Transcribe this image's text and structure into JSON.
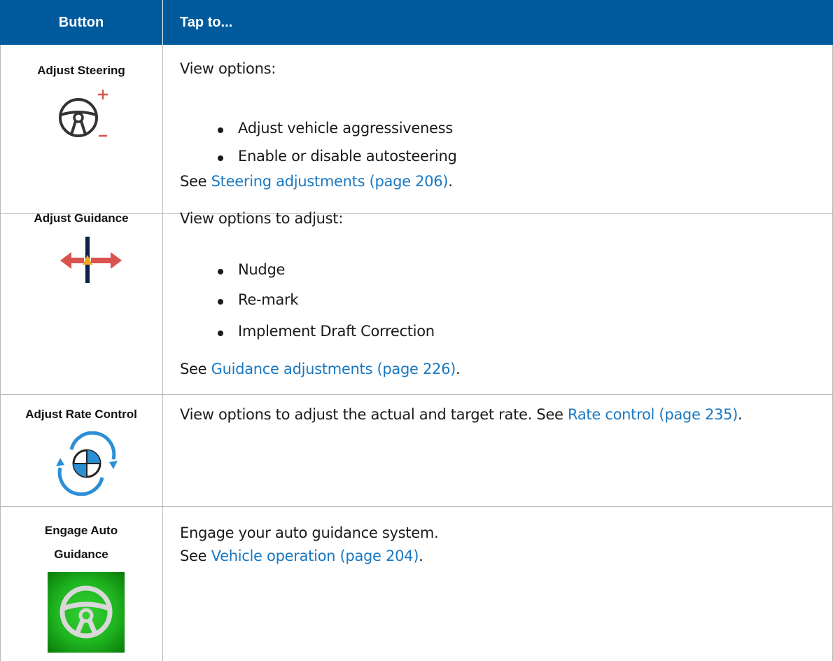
{
  "header": {
    "col_button": "Button",
    "col_tap": "Tap to..."
  },
  "rows": [
    {
      "button_label": "Adjust Steering",
      "icon": "steering-wheel-plus-minus-icon",
      "intro": "View options:",
      "bullets": [
        "Adjust vehicle aggressiveness",
        "Enable or disable autosteering"
      ],
      "see_prefix": "See ",
      "link": "Steering adjustments (page 206)",
      "see_suffix": "."
    },
    {
      "button_label": "Adjust Guidance",
      "icon": "guidance-arrows-icon",
      "intro": "View options to adjust:",
      "bullets": [
        "Nudge",
        "Re-mark",
        "Implement Draft Correction"
      ],
      "see_prefix": "See ",
      "link": "Guidance adjustments (page 226)",
      "see_suffix": "."
    },
    {
      "button_label": "Adjust Rate Control",
      "icon": "rate-control-icon",
      "intro": "View options to adjust the actual and target rate. See ",
      "link": "Rate control (page 235)",
      "see_suffix": "."
    },
    {
      "button_label_line1": "Engage Auto",
      "button_label_line2": "Guidance",
      "icon": "engage-steering-wheel-icon",
      "intro": "Engage your auto guidance system.",
      "see_prefix": "See ",
      "link": "Vehicle operation (page 204)",
      "see_suffix": "."
    }
  ],
  "colors": {
    "header_bg": "#005a9c",
    "link": "#1a78c2",
    "grid": "#b8b8b8",
    "engage_green": "#1fb51f",
    "arrow_red": "#d9534f"
  }
}
